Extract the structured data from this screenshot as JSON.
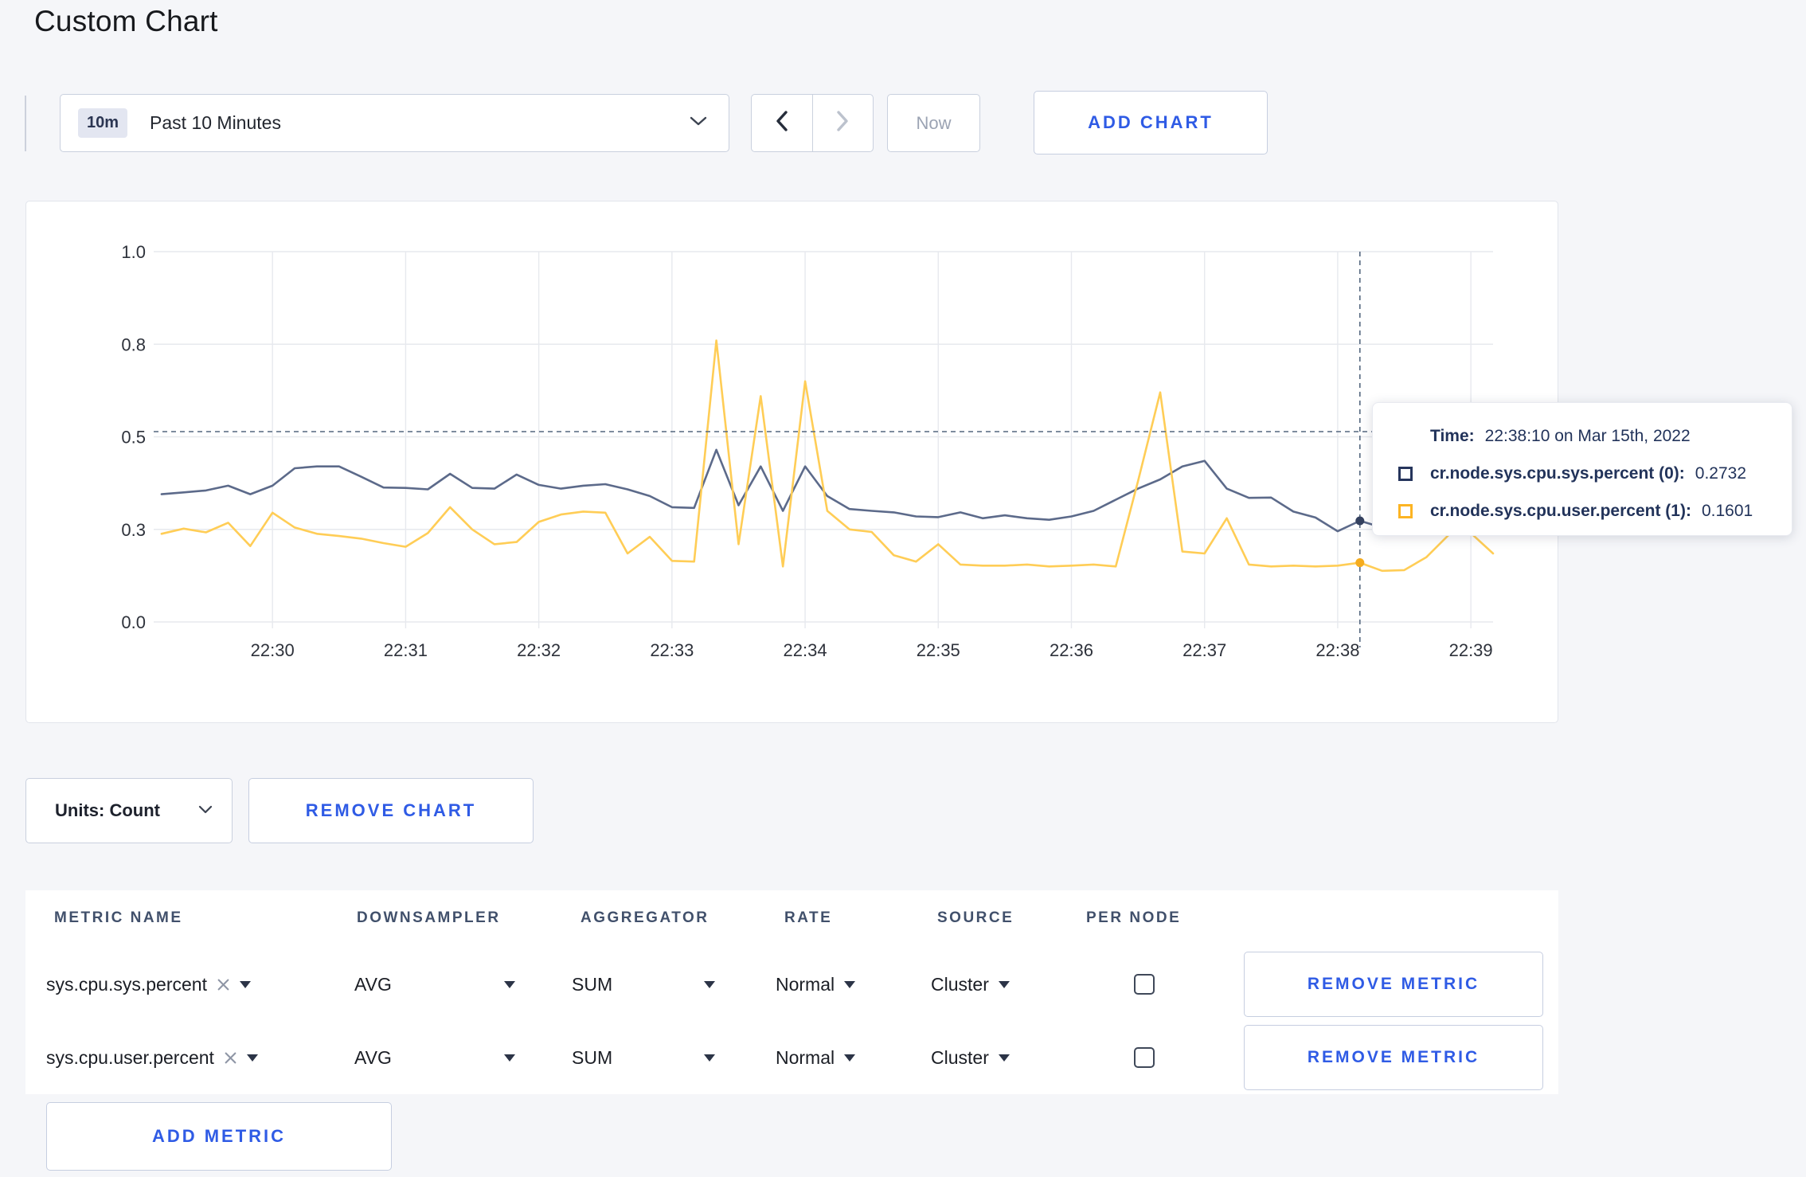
{
  "page": {
    "title": "Custom Chart"
  },
  "toolbar": {
    "time_range_badge": "10m",
    "time_range_label": "Past 10 Minutes",
    "now_label": "Now",
    "add_chart_label": "ADD CHART"
  },
  "icons": {
    "time_range_dropdown": "chevron-down",
    "prev": "chevron-left",
    "next": "chevron-right",
    "units_dropdown": "chevron-down",
    "metric_clear": "x",
    "select_caret": "triangle-down",
    "tooltip_series_swatch": "outlined-square"
  },
  "colors": {
    "accent_blue": "#2f5be5",
    "series_sys": "#5c6a8a",
    "series_user": "#ffcd56",
    "marker_sys": "#34415f",
    "marker_user": "#f5ac1e",
    "crosshair": "#54677f",
    "grid": "#e7e9ee"
  },
  "tooltip": {
    "time_label": "Time:",
    "time_value": "22:38:10 on Mar 15th, 2022",
    "series": [
      {
        "name": "cr.node.sys.cpu.sys.percent (0):",
        "value": "0.2732",
        "swatch_color": "#26355c"
      },
      {
        "name": "cr.node.sys.cpu.user.percent (1):",
        "value": "0.1601",
        "swatch_color": "#fcb423"
      }
    ]
  },
  "chart_controls": {
    "units_label": "Units: Count",
    "remove_chart_label": "REMOVE CHART"
  },
  "metrics_table": {
    "headers": [
      "METRIC NAME",
      "DOWNSAMPLER",
      "AGGREGATOR",
      "RATE",
      "SOURCE",
      "PER NODE"
    ],
    "rows": [
      {
        "metric_name": "sys.cpu.sys.percent",
        "downsampler": "AVG",
        "aggregator": "SUM",
        "rate": "Normal",
        "source": "Cluster",
        "per_node_checked": false,
        "remove_label": "REMOVE METRIC"
      },
      {
        "metric_name": "sys.cpu.user.percent",
        "downsampler": "AVG",
        "aggregator": "SUM",
        "rate": "Normal",
        "source": "Cluster",
        "per_node_checked": false,
        "remove_label": "REMOVE METRIC"
      }
    ],
    "add_metric_label": "ADD METRIC"
  },
  "chart_data": {
    "type": "line",
    "title": "",
    "ylim": [
      0,
      1
    ],
    "grid": true,
    "legend_position": "tooltip-only",
    "x_base_time": "22:29:00",
    "x_domain_seconds": [
      0,
      610
    ],
    "x_ticks": [
      {
        "t": 60,
        "label": "22:30"
      },
      {
        "t": 120,
        "label": "22:31"
      },
      {
        "t": 180,
        "label": "22:32"
      },
      {
        "t": 240,
        "label": "22:33"
      },
      {
        "t": 300,
        "label": "22:34"
      },
      {
        "t": 360,
        "label": "22:35"
      },
      {
        "t": 420,
        "label": "22:36"
      },
      {
        "t": 480,
        "label": "22:37"
      },
      {
        "t": 540,
        "label": "22:38"
      },
      {
        "t": 600,
        "label": "22:39"
      }
    ],
    "y_ticks": [
      {
        "v": 0.0,
        "label": "0.0"
      },
      {
        "v": 0.25,
        "label": "0.3"
      },
      {
        "v": 0.5,
        "label": "0.5"
      },
      {
        "v": 0.75,
        "label": "0.8"
      },
      {
        "v": 1.0,
        "label": "1.0"
      }
    ],
    "t_seconds": [
      10,
      20,
      30,
      40,
      50,
      60,
      70,
      80,
      90,
      100,
      110,
      120,
      130,
      140,
      150,
      160,
      170,
      180,
      190,
      200,
      210,
      220,
      230,
      240,
      250,
      260,
      270,
      280,
      290,
      300,
      310,
      320,
      330,
      340,
      350,
      360,
      370,
      380,
      390,
      400,
      410,
      420,
      430,
      440,
      450,
      460,
      470,
      480,
      490,
      500,
      510,
      520,
      530,
      540,
      550,
      560,
      570,
      580,
      590,
      600,
      610
    ],
    "series": [
      {
        "name": "cr.node.sys.cpu.sys.percent",
        "color": "#5c6a8a",
        "values": [
          0.345,
          0.35,
          0.355,
          0.368,
          0.345,
          0.368,
          0.415,
          0.42,
          0.42,
          0.392,
          0.363,
          0.362,
          0.358,
          0.4,
          0.362,
          0.36,
          0.398,
          0.37,
          0.36,
          0.368,
          0.372,
          0.358,
          0.34,
          0.31,
          0.308,
          0.465,
          0.315,
          0.42,
          0.3,
          0.42,
          0.34,
          0.305,
          0.3,
          0.296,
          0.285,
          0.283,
          0.296,
          0.28,
          0.288,
          0.28,
          0.276,
          0.285,
          0.3,
          0.33,
          0.36,
          0.385,
          0.42,
          0.435,
          0.36,
          0.335,
          0.336,
          0.298,
          0.282,
          0.245,
          0.2732,
          0.255,
          0.27,
          0.262,
          0.268,
          0.272,
          0.268
        ]
      },
      {
        "name": "cr.node.sys.cpu.user.percent",
        "color": "#ffcd56",
        "values": [
          0.238,
          0.252,
          0.242,
          0.268,
          0.205,
          0.295,
          0.255,
          0.238,
          0.232,
          0.225,
          0.213,
          0.203,
          0.24,
          0.31,
          0.25,
          0.21,
          0.216,
          0.27,
          0.29,
          0.298,
          0.295,
          0.185,
          0.23,
          0.165,
          0.163,
          0.76,
          0.21,
          0.61,
          0.15,
          0.65,
          0.3,
          0.25,
          0.243,
          0.18,
          0.163,
          0.21,
          0.155,
          0.152,
          0.152,
          0.155,
          0.15,
          0.152,
          0.155,
          0.15,
          0.38,
          0.62,
          0.19,
          0.185,
          0.28,
          0.155,
          0.15,
          0.152,
          0.15,
          0.152,
          0.1601,
          0.138,
          0.14,
          0.175,
          0.235,
          0.24,
          0.185
        ]
      }
    ],
    "crosshair": {
      "t": 550,
      "y_value": 0.514
    },
    "markers": [
      {
        "series": 0,
        "t": 550,
        "v": 0.2732
      },
      {
        "series": 1,
        "t": 550,
        "v": 0.1601
      }
    ]
  }
}
